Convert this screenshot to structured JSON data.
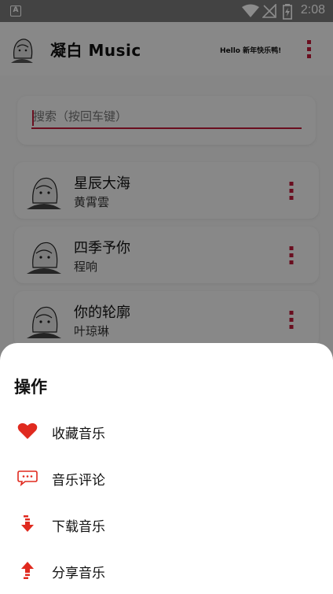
{
  "status_bar": {
    "time": "2:08",
    "app_indicator": "A"
  },
  "header": {
    "title": "凝白 Music",
    "greeting": "Hello 新年快乐鸭!"
  },
  "search": {
    "placeholder": "搜索（按回车键）"
  },
  "songs": [
    {
      "title": "星辰大海",
      "artist": "黄霄雲"
    },
    {
      "title": "四季予你",
      "artist": "程响"
    },
    {
      "title": "你的轮廓",
      "artist": "叶琼琳"
    }
  ],
  "sheet": {
    "title": "操作",
    "actions": [
      {
        "label": "收藏音乐",
        "icon": "heart-icon"
      },
      {
        "label": "音乐评论",
        "icon": "comment-icon"
      },
      {
        "label": "下载音乐",
        "icon": "download-icon"
      },
      {
        "label": "分享音乐",
        "icon": "share-icon"
      }
    ]
  },
  "colors": {
    "accent": "#c21a3a",
    "icon_red": "#e02a1f"
  }
}
